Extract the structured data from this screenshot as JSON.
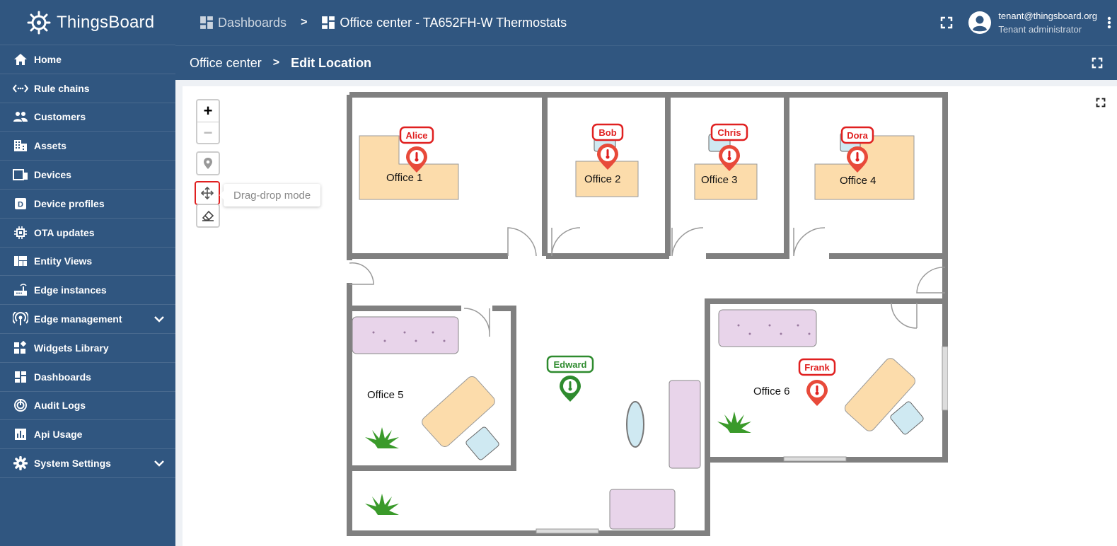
{
  "app": {
    "name": "ThingsBoard"
  },
  "sidebar": {
    "items": [
      {
        "label": "Home",
        "icon": "home-icon"
      },
      {
        "label": "Rule chains",
        "icon": "code-arrows-icon"
      },
      {
        "label": "Customers",
        "icon": "people-icon"
      },
      {
        "label": "Assets",
        "icon": "building-icon"
      },
      {
        "label": "Devices",
        "icon": "devices-icon"
      },
      {
        "label": "Device profiles",
        "icon": "profile-d-icon"
      },
      {
        "label": "OTA updates",
        "icon": "chip-icon"
      },
      {
        "label": "Entity Views",
        "icon": "view-quilt-icon"
      },
      {
        "label": "Edge instances",
        "icon": "router-icon"
      },
      {
        "label": "Edge management",
        "icon": "antenna-icon",
        "expandable": true
      },
      {
        "label": "Widgets Library",
        "icon": "widgets-icon"
      },
      {
        "label": "Dashboards",
        "icon": "dashboard-icon"
      },
      {
        "label": "Audit Logs",
        "icon": "track-changes-icon"
      },
      {
        "label": "Api Usage",
        "icon": "insert-chart-icon"
      },
      {
        "label": "System Settings",
        "icon": "gear-icon",
        "expandable": true
      }
    ]
  },
  "header": {
    "breadcrumb": [
      {
        "label": "Dashboards",
        "icon": "dashboard-icon"
      },
      {
        "label": "Office center - TA652FH-W Thermostats",
        "icon": "dashboard-icon"
      }
    ],
    "separator": ">",
    "user": {
      "email": "tenant@thingsboard.org",
      "role": "Tenant administrator"
    }
  },
  "subheader": {
    "state": "Office center",
    "separator": ">",
    "current": "Edit Location"
  },
  "map": {
    "zoom_in": "+",
    "zoom_out": "−",
    "tooltip": "Drag-drop mode",
    "offices": [
      "Office 1",
      "Office 2",
      "Office 3",
      "Office 4",
      "Office 5",
      "Office 6"
    ],
    "markers": [
      {
        "name": "Alice",
        "status": "alarm"
      },
      {
        "name": "Bob",
        "status": "alarm"
      },
      {
        "name": "Chris",
        "status": "alarm"
      },
      {
        "name": "Dora",
        "status": "alarm"
      },
      {
        "name": "Edward",
        "status": "ok"
      },
      {
        "name": "Frank",
        "status": "alarm"
      }
    ]
  },
  "colors": {
    "primary": "#305680",
    "alarm": "#e02020",
    "ok": "#2e8b2e",
    "desk": "#fcdcab",
    "sofa": "#e8d4ea",
    "wall": "#808080"
  }
}
